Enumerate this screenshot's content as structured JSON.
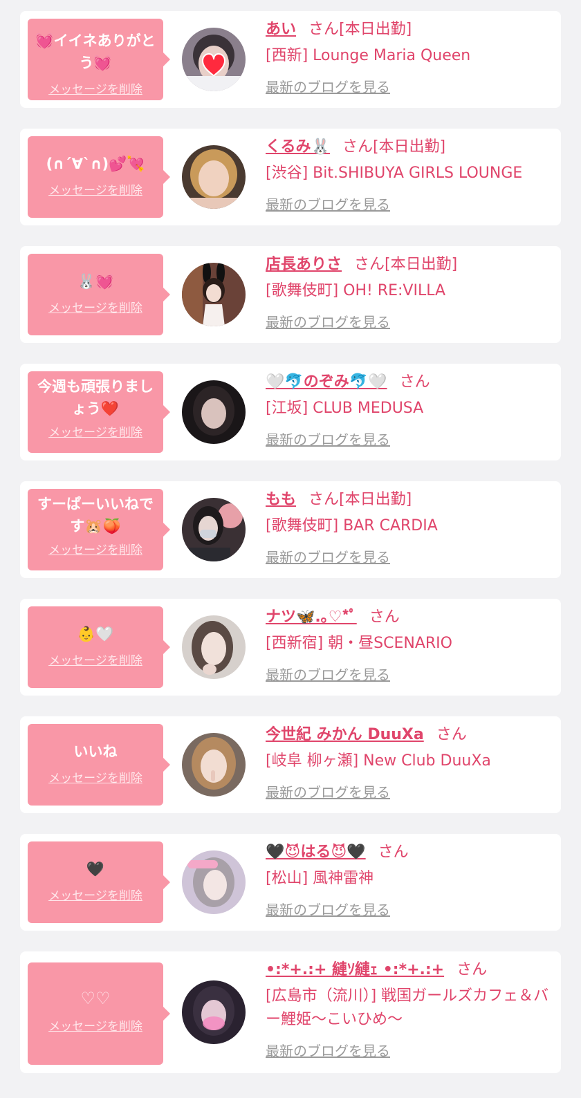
{
  "delete_label": "メッセージを削除",
  "blog_label": "最新のブログを見る",
  "san_label": "さん",
  "colors": {
    "background": "#f2f2f4",
    "bubble": "#f997a7",
    "accent": "#e0456b",
    "link_gray": "#9a9a9a"
  },
  "items": [
    {
      "message": "💓イイネありがとう💓",
      "name": "あい",
      "status": "[本日出勤]",
      "shop": "[西新] Lounge Maria Queen",
      "avatar_icon": "heart-sticker-photo"
    },
    {
      "message": "(∩´∀`∩)💕💘",
      "name": "くるみ🐰",
      "status": "[本日出勤]",
      "shop": "[渋谷] Bit.SHIBUYA GIRLS LOUNGE",
      "avatar_icon": "portrait-photo"
    },
    {
      "message": "🐰💓",
      "name": "店長ありさ",
      "status": "[本日出勤]",
      "shop": "[歌舞伎町] OH! RE:VILLA",
      "avatar_icon": "bunny-ears-photo"
    },
    {
      "message": "今週も頑張りましょう❤️",
      "name": "🤍🐬のぞみ🐬🤍",
      "status": "",
      "shop": "[江坂] CLUB MEDUSA",
      "avatar_icon": "portrait-photo"
    },
    {
      "message": "すーぱーいいねです🐹🍑",
      "name": "もも",
      "status": "[本日出勤]",
      "shop": "[歌舞伎町] BAR CARDIA",
      "avatar_icon": "masked-portrait-photo"
    },
    {
      "message": "👶🤍",
      "name": "ナツ🦋.｡♡*ﾟ",
      "status": "",
      "shop": "[西新宿] 朝・昼SCENARIO",
      "avatar_icon": "portrait-photo"
    },
    {
      "message": "いいね",
      "name": "今世紀 みかん DuuXa",
      "status": "",
      "shop": "[岐阜 柳ヶ瀬] New Club DuuXa",
      "avatar_icon": "portrait-photo"
    },
    {
      "message": "🖤",
      "name": "🖤😈はる😈🖤",
      "status": "",
      "shop": "[松山] 風神雷神",
      "avatar_icon": "portrait-photo"
    },
    {
      "message": "♡♡",
      "name": "•:*+.:+ 縺ｿ縺ｪ •:*+.:+",
      "status": "",
      "shop": "[広島市（流川）] 戦国ガールズカフェ＆バー鯉姫〜こいひめ〜",
      "avatar_icon": "blurred-portrait-photo"
    }
  ]
}
